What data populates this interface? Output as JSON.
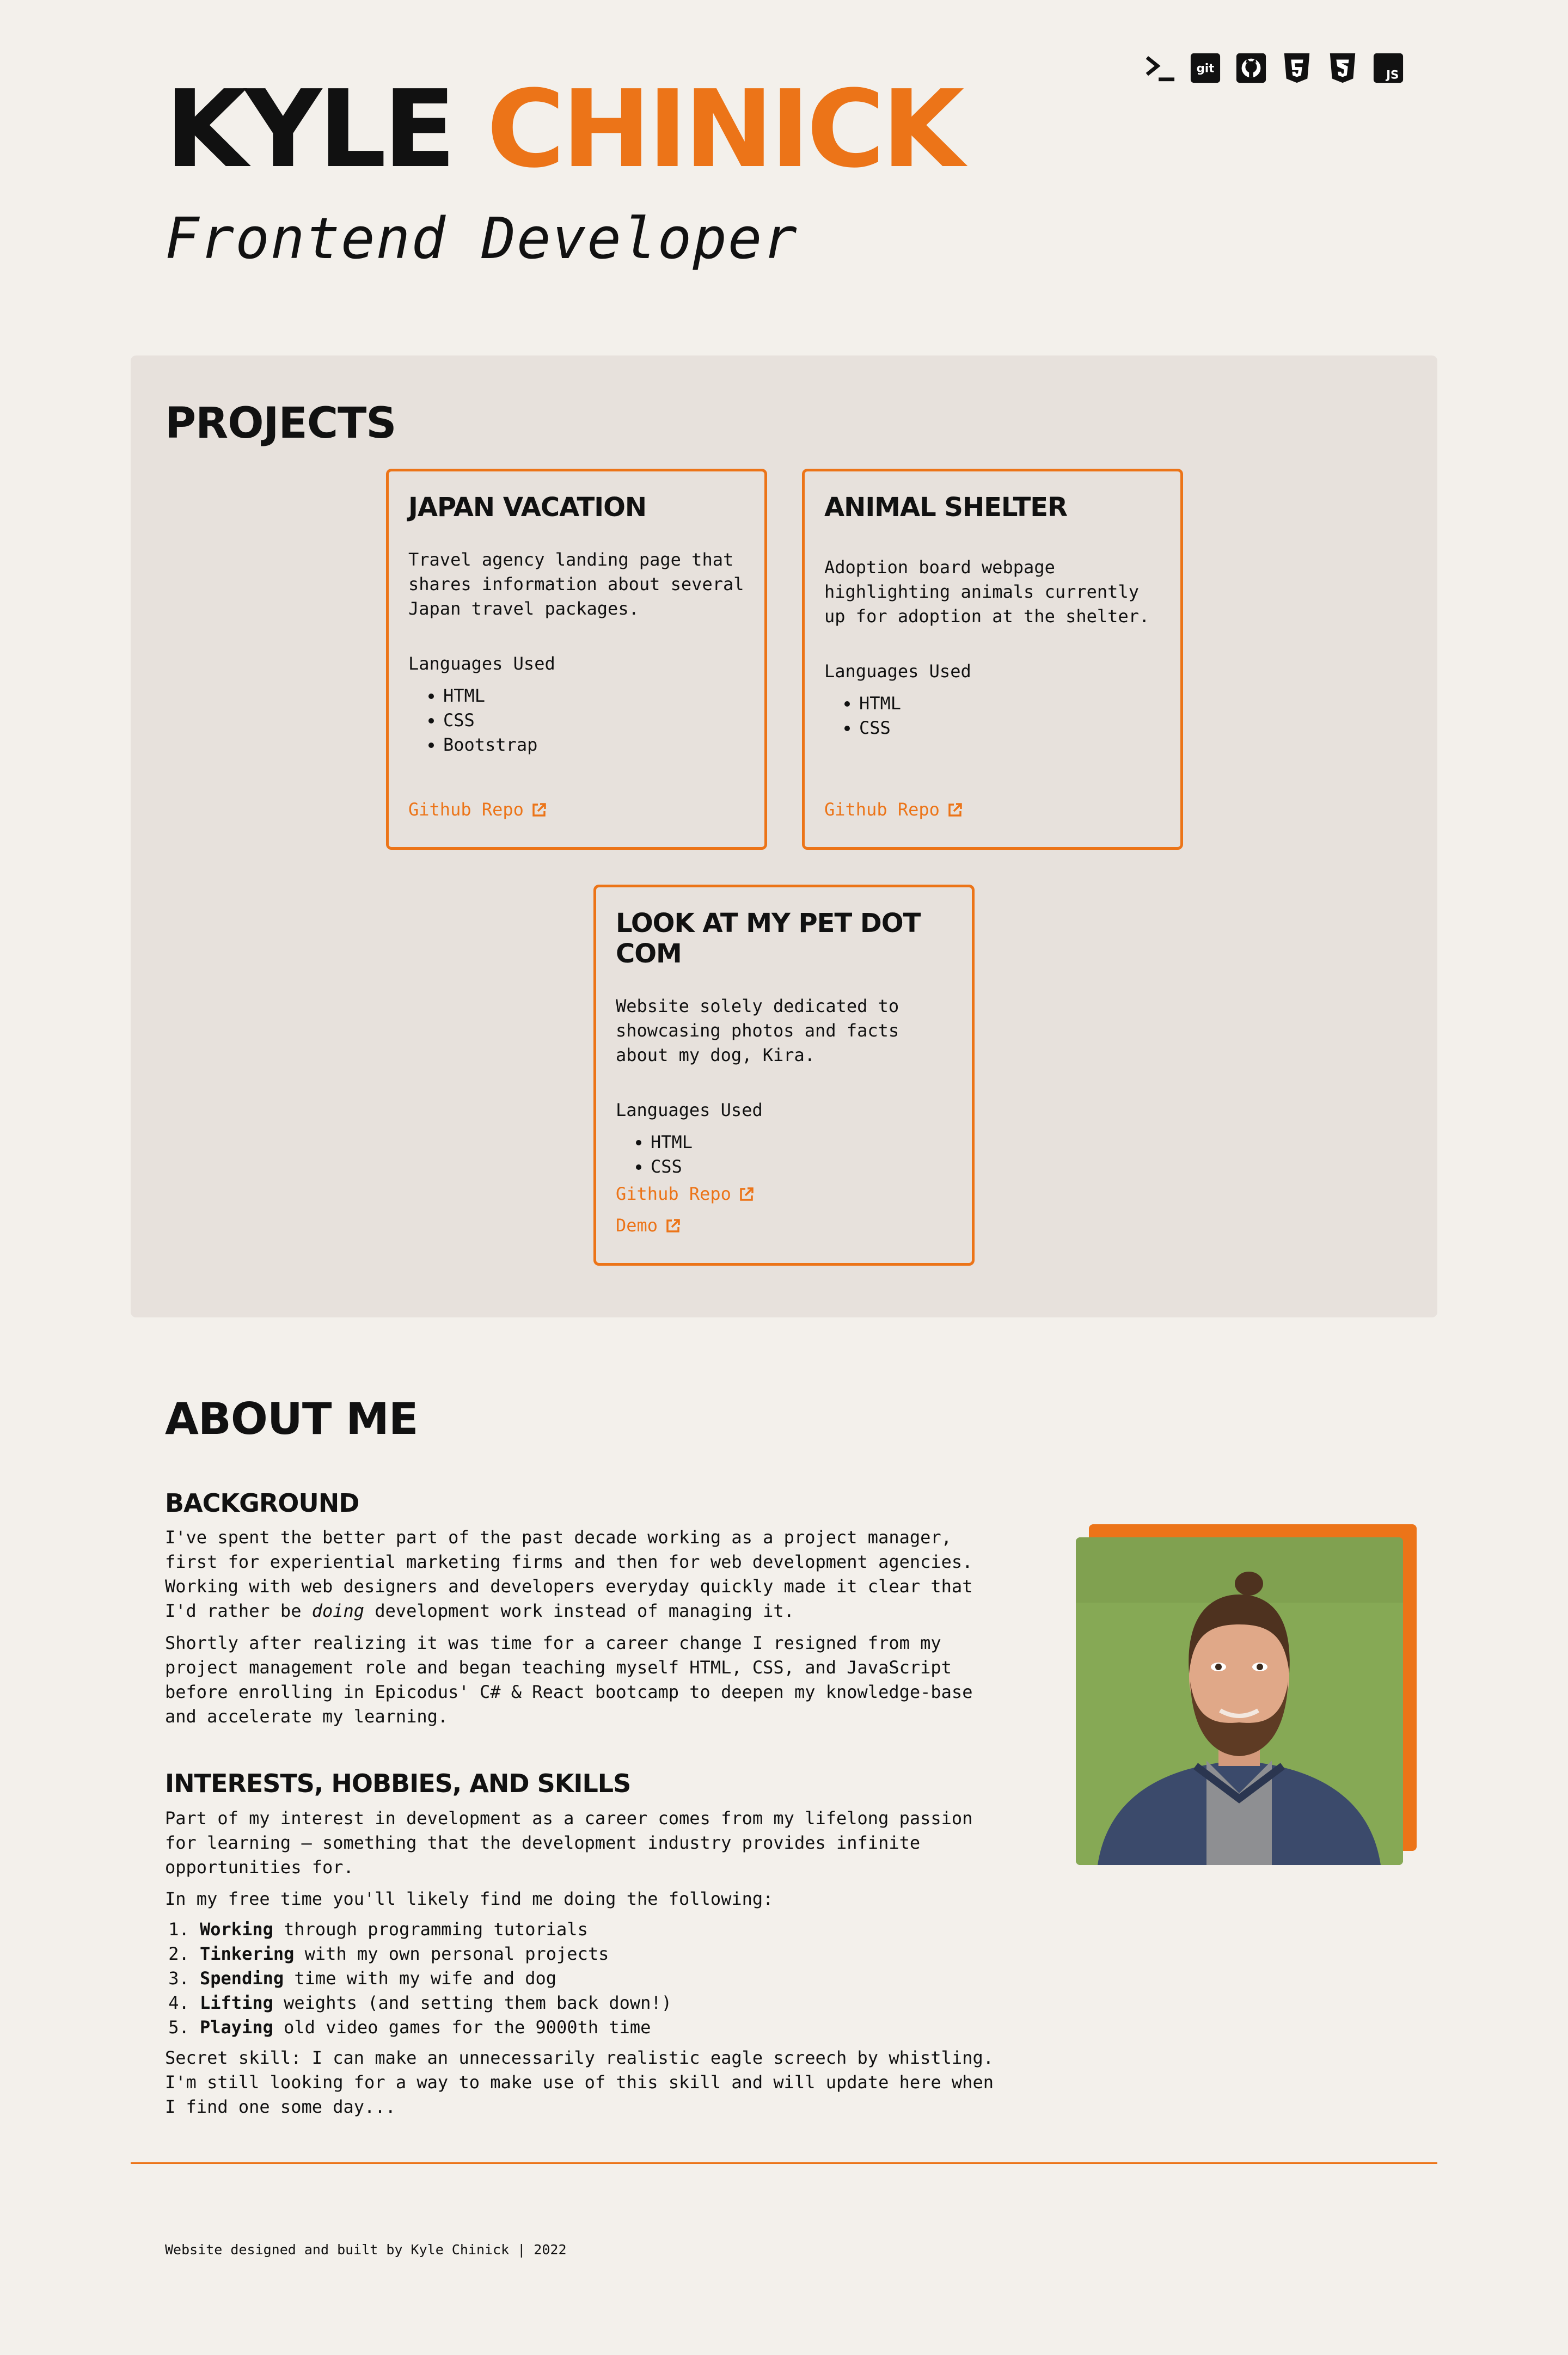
{
  "header": {
    "first_name": "KYLE",
    "last_name": "CHINICK",
    "role": "Frontend Developer",
    "tech_icons": [
      "terminal-icon",
      "git-icon",
      "github-icon",
      "html5-icon",
      "css3-icon",
      "javascript-icon"
    ],
    "git_icon_text": "git",
    "js_icon_text": "JS"
  },
  "projects": {
    "title": "PROJECTS",
    "cards": [
      {
        "title": "JAPAN VACATION",
        "description": "Travel agency landing page that shares information about several Japan travel packages.",
        "languages_label": "Languages Used",
        "languages": [
          "HTML",
          "CSS",
          "Bootstrap"
        ],
        "links": [
          "Github Repo"
        ]
      },
      {
        "title": "ANIMAL SHELTER",
        "description": "Adoption board webpage highlighting animals currently up for adoption at the shelter.",
        "languages_label": "Languages Used",
        "languages": [
          "HTML",
          "CSS"
        ],
        "links": [
          "Github Repo"
        ]
      },
      {
        "title": "LOOK AT MY PET DOT COM",
        "description": "Website solely dedicated to showcasing photos and facts about my dog, Kira.",
        "languages_label": "Languages Used",
        "languages": [
          "HTML",
          "CSS"
        ],
        "links": [
          "Github Repo",
          "Demo"
        ]
      }
    ]
  },
  "about": {
    "title": "ABOUT ME",
    "background": {
      "heading": "BACKGROUND",
      "p1_a": "I've spent the better part of the past decade working as a project manager, first for experiential marketing firms and then for web development agencies. Working with web designers and developers everyday quickly made it clear that I'd rather be ",
      "p1_em": "doing",
      "p1_b": " development work instead of managing it.",
      "p2": "Shortly after realizing it was time for a career change I resigned from my project management role and began teaching myself HTML, CSS, and JavaScript before enrolling in Epicodus' C# & React bootcamp to deepen my knowledge-base and accelerate my learning."
    },
    "interests": {
      "heading": "INTERESTS, HOBBIES, AND SKILLS",
      "p1": "Part of my interest in development as a career comes from my lifelong passion for learning — something that the development industry provides infinite opportunities for.",
      "p2": "In my free time you'll likely find me doing the following:",
      "items": [
        {
          "bold": "Working",
          "rest": " through programming tutorials"
        },
        {
          "bold": "Tinkering",
          "rest": " with my own personal projects"
        },
        {
          "bold": "Spending",
          "rest": " time with my wife and dog"
        },
        {
          "bold": "Lifting",
          "rest": " weights (and setting them back down!)"
        },
        {
          "bold": "Playing",
          "rest": " old video games for the 9000th time"
        }
      ],
      "p3": "Secret skill: I can make an unnecessarily realistic eagle screech by whistling. I'm still looking for a way to make use of this skill and will update here when I find one some day..."
    }
  },
  "footer": {
    "text": "Website designed and built by Kyle Chinick | 2022"
  },
  "colors": {
    "accent": "#ec7418",
    "background": "#f3f0eb",
    "panel": "#e7e1dc",
    "text": "#111111"
  }
}
